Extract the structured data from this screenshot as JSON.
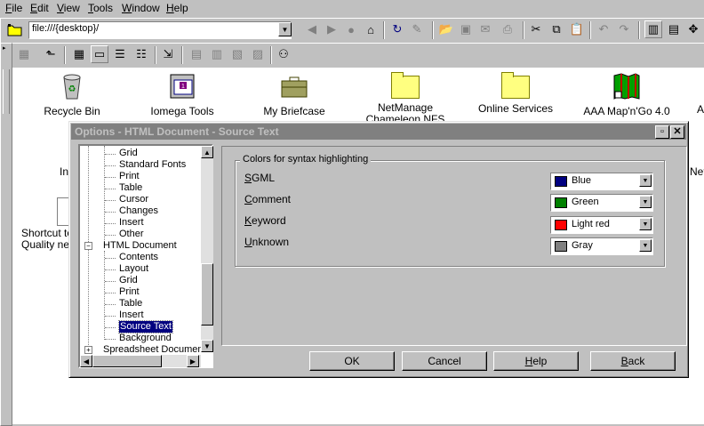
{
  "menu": [
    "File",
    "Edit",
    "View",
    "Tools",
    "Window",
    "Help"
  ],
  "address": {
    "value": "file:///{desktop}/"
  },
  "desktop_items": [
    {
      "label": "Recycle Bin",
      "icon": "recycle-bin-icon"
    },
    {
      "label": "Iomega Tools",
      "icon": "iomega-tools-icon"
    },
    {
      "label": "My Briefcase",
      "icon": "briefcase-icon"
    },
    {
      "label": "NetManage Chameleon NFS",
      "icon": "folder-icon"
    },
    {
      "label": "Online Services",
      "icon": "folder-icon"
    },
    {
      "label": "AAA Map'n'Go 4.0",
      "icon": "map-icon"
    }
  ],
  "desktop_partial": {
    "in_label": "In",
    "net_label": "Net",
    "shortcut_line1": "Shortcut to",
    "shortcut_line2": "Quality new",
    "a_label": "A"
  },
  "dialog": {
    "title": "Options - HTML Document - Source Text",
    "tree": [
      {
        "label": "Grid",
        "level": 2
      },
      {
        "label": "Standard Fonts",
        "level": 2
      },
      {
        "label": "Print",
        "level": 2
      },
      {
        "label": "Table",
        "level": 2
      },
      {
        "label": "Cursor",
        "level": 2
      },
      {
        "label": "Changes",
        "level": 2
      },
      {
        "label": "Insert",
        "level": 2
      },
      {
        "label": "Other",
        "level": 2
      },
      {
        "label": "HTML Document",
        "level": 1,
        "expander": "−"
      },
      {
        "label": "Contents",
        "level": 2
      },
      {
        "label": "Layout",
        "level": 2
      },
      {
        "label": "Grid",
        "level": 2
      },
      {
        "label": "Print",
        "level": 2
      },
      {
        "label": "Table",
        "level": 2
      },
      {
        "label": "Insert",
        "level": 2
      },
      {
        "label": "Source Text",
        "level": 2,
        "selected": true
      },
      {
        "label": "Background",
        "level": 2
      },
      {
        "label": "Spreadsheet Documen",
        "level": 1,
        "expander": "+"
      }
    ],
    "group_title": "Colors for syntax highlighting",
    "colors": [
      {
        "label": "SGML",
        "value": "Blue",
        "swatch": "#000080"
      },
      {
        "label": "Comment",
        "value": "Green",
        "swatch": "#008000"
      },
      {
        "label": "Keyword",
        "value": "Light red",
        "swatch": "#ff0000"
      },
      {
        "label": "Unknown",
        "value": "Gray",
        "swatch": "#808080"
      }
    ],
    "buttons": {
      "ok": "OK",
      "cancel": "Cancel",
      "help": "Help",
      "back": "Back"
    }
  }
}
